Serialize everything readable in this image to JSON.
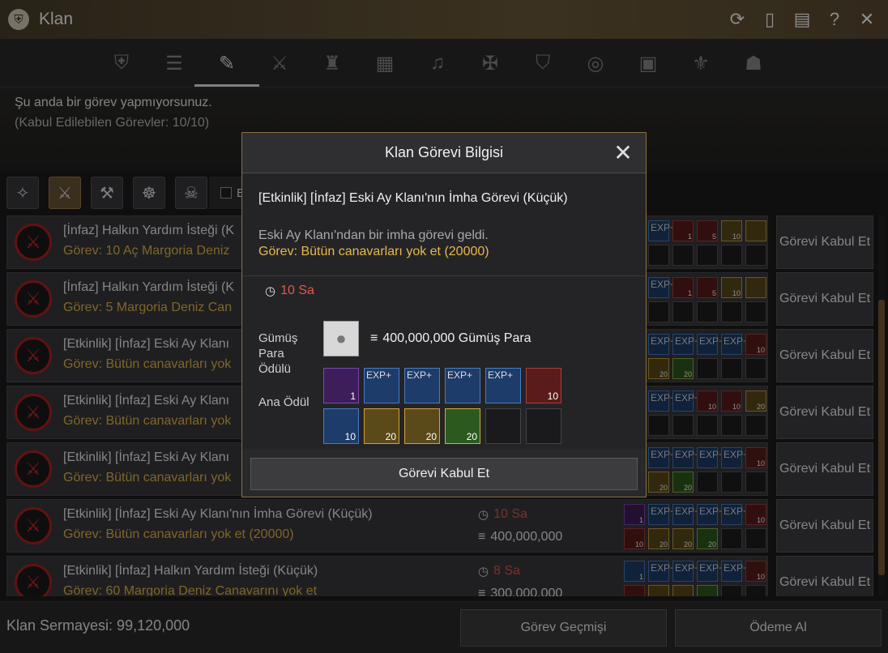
{
  "window": {
    "title": "Klan",
    "logo_icon": "clan-crest-icon"
  },
  "title_buttons": [
    "refresh-icon",
    "phone-icon",
    "document-icon",
    "help-icon",
    "close-icon"
  ],
  "tabs": [
    "clan-info-icon",
    "members-icon",
    "quests-icon",
    "war-icon",
    "fortress-icon",
    "notice-icon",
    "bell-icon",
    "alliance-icon",
    "shield-icon",
    "emblem-icon",
    "records-icon",
    "lily-icon",
    "mask-icon"
  ],
  "status": {
    "line1": "Şu anda bir görev yapmıyorsunuz.",
    "line2": "(Kabul Edilebilen Görevler: 10/10)"
  },
  "filter": {
    "checkbox_label": "E"
  },
  "quests": [
    {
      "title": "[İnfaz] Halkın Yardım İsteği (K",
      "desc": "Görev: 10 Aç Margoria Deniz",
      "time": "",
      "money": "",
      "accept": "Görevi Kabul Et",
      "slots": [
        [
          "q-blue",
          "",
          ""
        ],
        [
          "q-blue",
          "EXP+",
          ""
        ],
        [
          "q-red",
          "",
          "1"
        ],
        [
          "q-red",
          "",
          "5"
        ],
        [
          "q-yellow",
          "",
          "10"
        ],
        [
          "q-yellow",
          "",
          ""
        ],
        [
          "q-green",
          "",
          "10"
        ],
        [
          "",
          "",
          ""
        ],
        [
          "",
          "",
          ""
        ],
        [
          "",
          "",
          ""
        ],
        [
          "",
          "",
          ""
        ],
        [
          "",
          "",
          ""
        ]
      ]
    },
    {
      "title": "[İnfaz] Halkın Yardım İsteği (K",
      "desc": "Görev: 5 Margoria Deniz Can",
      "time": "",
      "money": "",
      "accept": "Görevi Kabul Et",
      "slots": [
        [
          "q-blue",
          "",
          ""
        ],
        [
          "q-blue",
          "EXP+",
          ""
        ],
        [
          "q-red",
          "",
          "1"
        ],
        [
          "q-red",
          "",
          "5"
        ],
        [
          "q-yellow",
          "",
          "10"
        ],
        [
          "q-yellow",
          "",
          ""
        ],
        [
          "q-green",
          "",
          "10"
        ],
        [
          "",
          "",
          ""
        ],
        [
          "",
          "",
          ""
        ],
        [
          "",
          "",
          ""
        ],
        [
          "",
          "",
          ""
        ],
        [
          "",
          "",
          ""
        ]
      ]
    },
    {
      "title": "[Etkinlik] [İnfaz] Eski Ay Klanı",
      "desc": "Görev: Bütün canavarları yok",
      "time": "",
      "money": "",
      "accept": "Görevi Kabul Et",
      "slots": [
        [
          "q-blue",
          "",
          ""
        ],
        [
          "q-blue",
          "EXP+",
          ""
        ],
        [
          "q-blue",
          "EXP+",
          ""
        ],
        [
          "q-blue",
          "EXP+",
          ""
        ],
        [
          "q-blue",
          "EXP+",
          ""
        ],
        [
          "q-red",
          "",
          "10"
        ],
        [
          "q-yellow",
          "",
          "20"
        ],
        [
          "q-yellow",
          "",
          "20"
        ],
        [
          "q-green",
          "",
          "20"
        ],
        [
          "",
          "",
          ""
        ],
        [
          "",
          "",
          ""
        ],
        [
          "",
          "",
          ""
        ]
      ]
    },
    {
      "title": "[Etkinlik] [İnfaz] Eski Ay Klanı",
      "desc": "Görev: Bütün canavarları yok",
      "time": "",
      "money": "",
      "accept": "Görevi Kabul Et",
      "slots": [
        [
          "q-blue",
          "",
          ""
        ],
        [
          "q-blue",
          "EXP+",
          ""
        ],
        [
          "q-blue",
          "EXP+",
          ""
        ],
        [
          "q-red",
          "",
          "10"
        ],
        [
          "q-red",
          "",
          "10"
        ],
        [
          "q-yellow",
          "",
          "20"
        ],
        [
          "q-green",
          "",
          "20"
        ],
        [
          "",
          "",
          ""
        ],
        [
          "",
          "",
          ""
        ],
        [
          "",
          "",
          ""
        ],
        [
          "",
          "",
          ""
        ],
        [
          "",
          "",
          ""
        ]
      ]
    },
    {
      "title": "[Etkinlik] [İnfaz] Eski Ay Klanı",
      "desc": "Görev: Bütün canavarları yok",
      "time": "",
      "money": "",
      "accept": "Görevi Kabul Et",
      "slots": [
        [
          "q-blue",
          "",
          ""
        ],
        [
          "q-blue",
          "EXP+",
          ""
        ],
        [
          "q-blue",
          "EXP+",
          ""
        ],
        [
          "q-blue",
          "EXP+",
          ""
        ],
        [
          "q-blue",
          "EXP+",
          ""
        ],
        [
          "q-red",
          "",
          "10"
        ],
        [
          "q-yellow",
          "",
          "20"
        ],
        [
          "q-yellow",
          "",
          "20"
        ],
        [
          "q-green",
          "",
          "20"
        ],
        [
          "",
          "",
          ""
        ],
        [
          "",
          "",
          ""
        ],
        [
          "",
          "",
          ""
        ]
      ]
    },
    {
      "title": "[Etkinlik] [İnfaz] Eski Ay Klanı'nın İmha Görevi (Küçük)",
      "desc": "Görev: Bütün canavarları yok et (20000)",
      "time": "10 Sa",
      "money": "400,000,000",
      "accept": "Görevi Kabul Et",
      "slots": [
        [
          "q-purple",
          "",
          "1"
        ],
        [
          "q-blue",
          "EXP+",
          ""
        ],
        [
          "q-blue",
          "EXP+",
          ""
        ],
        [
          "q-blue",
          "EXP+",
          ""
        ],
        [
          "q-blue",
          "EXP+",
          ""
        ],
        [
          "q-red",
          "",
          "10"
        ],
        [
          "q-red",
          "",
          "10"
        ],
        [
          "q-yellow",
          "",
          "20"
        ],
        [
          "q-yellow",
          "",
          "20"
        ],
        [
          "q-green",
          "",
          "20"
        ],
        [
          "",
          "",
          ""
        ],
        [
          "",
          "",
          ""
        ]
      ]
    },
    {
      "title": "[Etkinlik] [İnfaz] Halkın Yardım İsteği (Küçük)",
      "desc": "Görev: 60 Margoria Deniz Canavarını yok et",
      "time": "8 Sa",
      "money": "300,000,000",
      "accept": "Görevi Kabul Et",
      "slots": [
        [
          "q-blue",
          "",
          "1"
        ],
        [
          "q-blue",
          "EXP+",
          ""
        ],
        [
          "q-blue",
          "EXP+",
          ""
        ],
        [
          "q-blue",
          "EXP+",
          ""
        ],
        [
          "q-blue",
          "EXP+",
          ""
        ],
        [
          "q-red",
          "",
          "10"
        ],
        [
          "q-red",
          "",
          ""
        ],
        [
          "q-yellow",
          "",
          ""
        ],
        [
          "q-yellow",
          "",
          ""
        ],
        [
          "q-green",
          "",
          ""
        ],
        [
          "",
          "",
          ""
        ],
        [
          "",
          "",
          ""
        ]
      ]
    }
  ],
  "footer": {
    "capital": "Klan Sermayesi: 99,120,000",
    "history": "Görev Geçmişi",
    "pay": "Ödeme Al"
  },
  "modal": {
    "header": "Klan Görevi Bilgisi",
    "title": "[Etkinlik] [İnfaz] Eski Ay Klanı'nın İmha Görevi (Küçük)",
    "intro": "Eski Ay Klanı'ndan bir imha görevi geldi.",
    "task": "Görev: Bütün canavarları yok et (20000)",
    "time": "10 Sa",
    "silver_label": "Gümüş Para Ödülü",
    "silver_amount": "400,000,000 Gümüş Para",
    "main_label": "Ana Ödül",
    "rewards": [
      [
        "q-purple",
        "",
        "1"
      ],
      [
        "q-blue",
        "EXP+",
        ""
      ],
      [
        "q-blue",
        "EXP+",
        ""
      ],
      [
        "q-blue",
        "EXP+",
        ""
      ],
      [
        "q-blue",
        "EXP+",
        ""
      ],
      [
        "q-red",
        "",
        "10"
      ],
      [
        "q-blue",
        "",
        "10"
      ],
      [
        "q-yellow",
        "",
        "20"
      ],
      [
        "q-yellow",
        "",
        "20"
      ],
      [
        "q-green",
        "",
        "20"
      ],
      [
        "",
        "",
        ""
      ],
      [
        "",
        "",
        ""
      ]
    ],
    "accept": "Görevi Kabul Et"
  }
}
